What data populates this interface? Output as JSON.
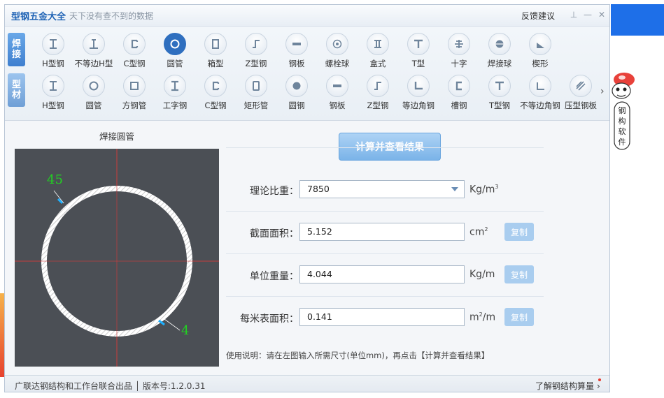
{
  "window": {
    "title": "型钢五金大全",
    "subtitle": "天下没有查不到的数据",
    "feedback_label": "反馈建议",
    "pin_glyph": "⊥",
    "min_glyph": "—",
    "close_glyph": "✕"
  },
  "category_tabs": [
    {
      "label_top": "焊",
      "label_bottom": "接"
    },
    {
      "label_top": "型",
      "label_bottom": "材"
    }
  ],
  "weld_items": [
    {
      "label": "H型钢",
      "icon": "h-beam-icon"
    },
    {
      "label": "不等边H型",
      "icon": "unequal-h-beam-icon"
    },
    {
      "label": "C型钢",
      "icon": "c-channel-icon"
    },
    {
      "label": "圆管",
      "icon": "round-tube-icon",
      "selected": true
    },
    {
      "label": "箱型",
      "icon": "box-section-icon"
    },
    {
      "label": "Z型钢",
      "icon": "z-section-icon"
    },
    {
      "label": "钢板",
      "icon": "steel-plate-icon"
    },
    {
      "label": "螺栓球",
      "icon": "bolt-ball-icon"
    },
    {
      "label": "盒式",
      "icon": "box-type-icon"
    },
    {
      "label": "T型",
      "icon": "t-section-icon"
    },
    {
      "label": "十字",
      "icon": "cross-section-icon"
    },
    {
      "label": "焊接球",
      "icon": "welded-ball-icon"
    },
    {
      "label": "楔形",
      "icon": "wedge-icon"
    }
  ],
  "profile_items": [
    {
      "label": "H型钢",
      "icon": "h-beam-icon"
    },
    {
      "label": "圆管",
      "icon": "round-tube-icon"
    },
    {
      "label": "方钢管",
      "icon": "square-tube-icon"
    },
    {
      "label": "工字钢",
      "icon": "i-beam-icon"
    },
    {
      "label": "C型钢",
      "icon": "c-channel-icon"
    },
    {
      "label": "矩形管",
      "icon": "rect-tube-icon"
    },
    {
      "label": "圆钢",
      "icon": "round-bar-icon"
    },
    {
      "label": "钢板",
      "icon": "steel-plate-icon"
    },
    {
      "label": "Z型钢",
      "icon": "z-section-icon"
    },
    {
      "label": "等边角钢",
      "icon": "equal-angle-icon"
    },
    {
      "label": "槽钢",
      "icon": "channel-icon"
    },
    {
      "label": "T型钢",
      "icon": "t-section-icon"
    },
    {
      "label": "不等边角钢",
      "icon": "unequal-angle-icon"
    },
    {
      "label": "压型钢板",
      "icon": "profiled-sheet-icon"
    }
  ],
  "more_glyph": "›",
  "preview": {
    "title": "焊接圆管",
    "outer_diameter": "45",
    "thickness": "4"
  },
  "calc_button": "计算并查看结果",
  "fields": {
    "density": {
      "label": "理论比重：",
      "value": "7850",
      "unit_main": "Kg/m",
      "unit_sup": "3"
    },
    "area": {
      "label": "截面面积：",
      "value": "5.152",
      "unit_main": "cm",
      "unit_sup": "2",
      "copy": "复制"
    },
    "weight": {
      "label": "单位重量：",
      "value": "4.044",
      "unit_main": "Kg/m",
      "copy": "复制"
    },
    "surface": {
      "label": "每米表面积：",
      "value": "0.141",
      "unit_pre": "m",
      "unit_sup": "2",
      "unit_post": "/m",
      "copy": "复制"
    }
  },
  "note": "使用说明：请在左图输入所需尺寸(单位mm)，再点击【计算并查看结果】",
  "status": {
    "left": "广联达钢结构和工作台联合出品 │ 版本号:1.2.0.31",
    "right": "了解钢结构算量 ›"
  },
  "mascot_text": [
    "钢",
    "构",
    "软",
    "件"
  ],
  "colors": {
    "accent": "#2f6fbf",
    "title": "#1f63b5",
    "dimension": "#22d122"
  }
}
